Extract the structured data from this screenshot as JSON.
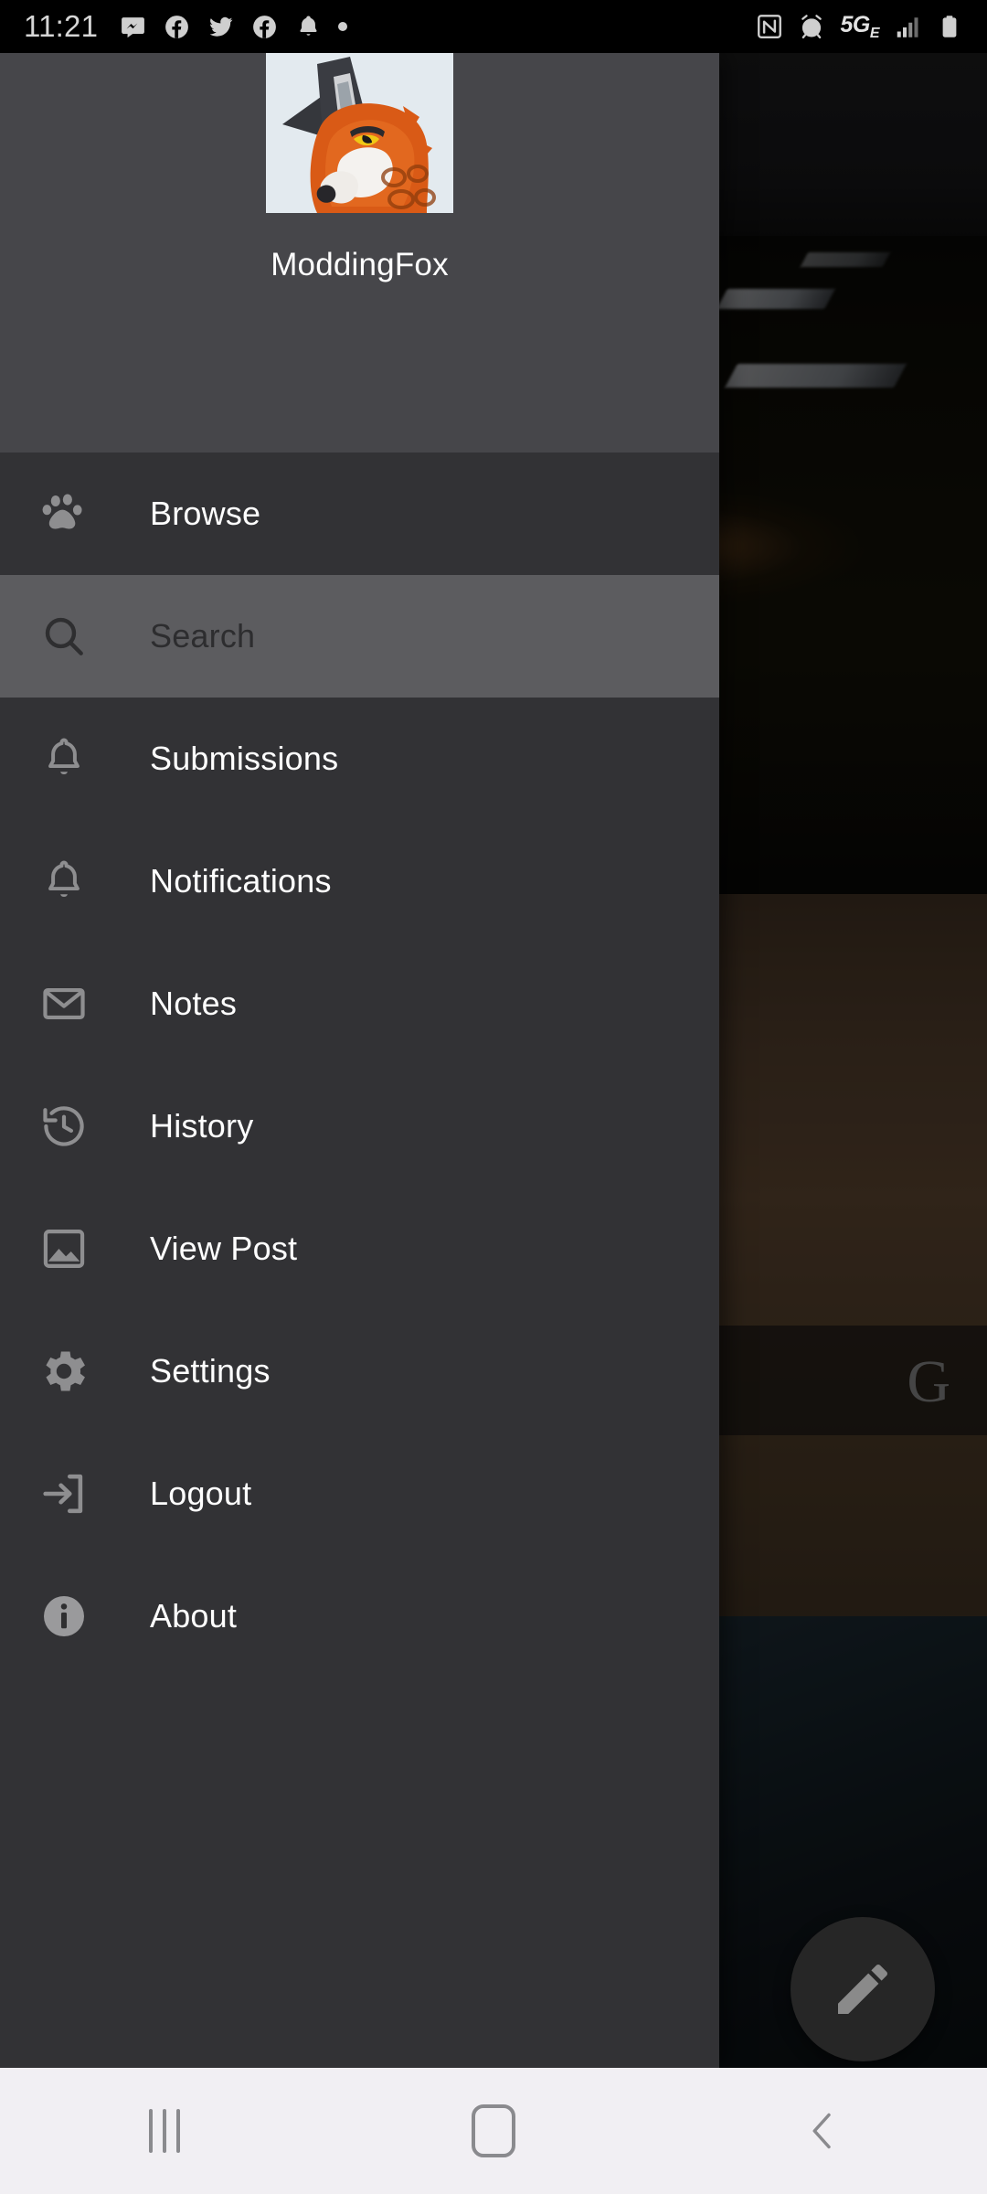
{
  "statusbar": {
    "time": "11:21",
    "left_icons": [
      "messenger-icon",
      "facebook-icon",
      "twitter-icon",
      "facebook-icon",
      "bell-icon",
      "dot-indicator-icon"
    ],
    "network_label": "5G",
    "network_sub": "E",
    "right_icons": [
      "nfc-icon",
      "alarm-icon",
      "network-5ge-label",
      "signal-bars-icon",
      "battery-icon"
    ]
  },
  "drawer": {
    "username": "ModdingFox",
    "avatar_name": "fox-avatar",
    "items": [
      {
        "label": "Browse",
        "icon": "paw-icon",
        "selected": false
      },
      {
        "label": "Search",
        "icon": "search-icon",
        "selected": true
      },
      {
        "label": "Submissions",
        "icon": "bell-icon",
        "selected": false
      },
      {
        "label": "Notifications",
        "icon": "bell-icon",
        "selected": false
      },
      {
        "label": "Notes",
        "icon": "envelope-icon",
        "selected": false
      },
      {
        "label": "History",
        "icon": "history-icon",
        "selected": false
      },
      {
        "label": "View Post",
        "icon": "image-icon",
        "selected": false
      },
      {
        "label": "Settings",
        "icon": "gear-icon",
        "selected": false
      },
      {
        "label": "Logout",
        "icon": "logout-icon",
        "selected": false
      },
      {
        "label": "About",
        "icon": "info-icon",
        "selected": false
      }
    ]
  },
  "content": {
    "rating_badge": "G",
    "fab_icon": "pencil-icon"
  },
  "navbar": {
    "recents_label": "recents-button",
    "home_label": "home-button",
    "back_label": "back-button"
  },
  "colors": {
    "drawer_header_bg": "#46464a",
    "drawer_bg": "#323235",
    "selected_row_bg": "#5c5c5f",
    "icon_gray": "#8e8e90",
    "text_white": "#ffffff",
    "navbar_bg": "#f1eff3",
    "statusbar_bg": "#000000"
  }
}
